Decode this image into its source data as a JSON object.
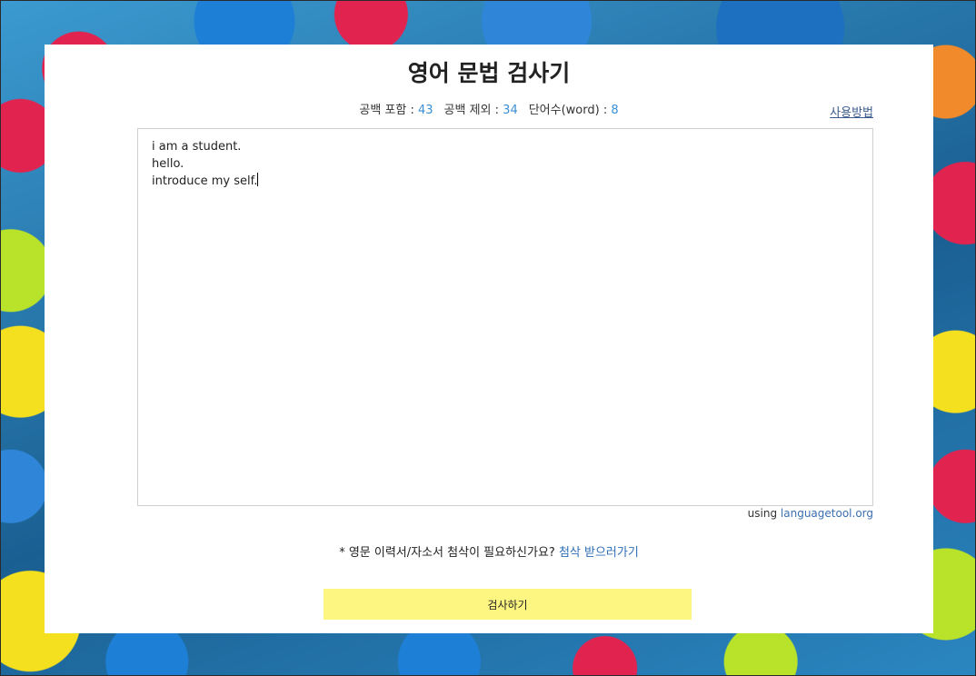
{
  "header": {
    "title": "영어 문법 검사기",
    "help_link": "사용방법"
  },
  "stats": {
    "with_spaces_label": "공백 포함 : ",
    "with_spaces_value": "43",
    "without_spaces_label": "공백 제외 : ",
    "without_spaces_value": "34",
    "words_label": "단어수(word) : ",
    "words_value": "8"
  },
  "editor": {
    "lines": [
      "i am a student.",
      "hello.",
      "introduce my self."
    ]
  },
  "credit": {
    "prefix": "using ",
    "link": "languagetool.org"
  },
  "notice": {
    "text": "* 영문 이력서/자소서 첨삭이 필요하신가요? ",
    "link": "첨삭 받으러가기"
  },
  "actions": {
    "check_label": "검사하기"
  },
  "colors": {
    "count_value": "#3a8fd6",
    "check_button": "#fdf680",
    "link": "#2d6db5"
  }
}
